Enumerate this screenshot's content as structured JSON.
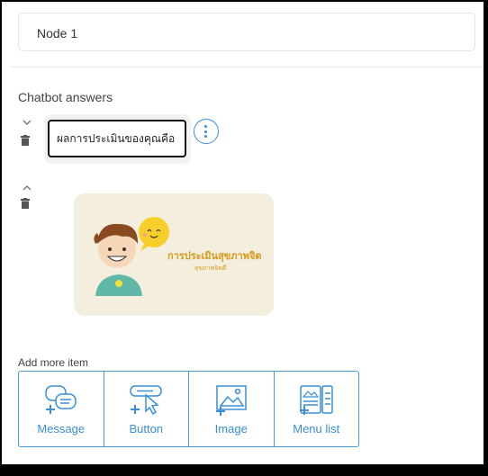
{
  "node": {
    "name": "Node 1"
  },
  "section": {
    "title": "Chatbot answers"
  },
  "message": {
    "text": "ผลการประเมินของคุณคือ"
  },
  "image_card": {
    "title": "การประเมินสุขภาพจิต",
    "subtitle": "สุขภาพจิตดี"
  },
  "add_more": {
    "label": "Add more item",
    "items": [
      {
        "label": "Message",
        "icon": "message-add-icon"
      },
      {
        "label": "Button",
        "icon": "button-add-icon"
      },
      {
        "label": "Image",
        "icon": "image-add-icon"
      },
      {
        "label": "Menu list",
        "icon": "menu-list-add-icon"
      }
    ]
  },
  "colors": {
    "accent": "#3a8fd6",
    "card_bg": "#f3eedd",
    "card_text": "#d79a1b"
  }
}
